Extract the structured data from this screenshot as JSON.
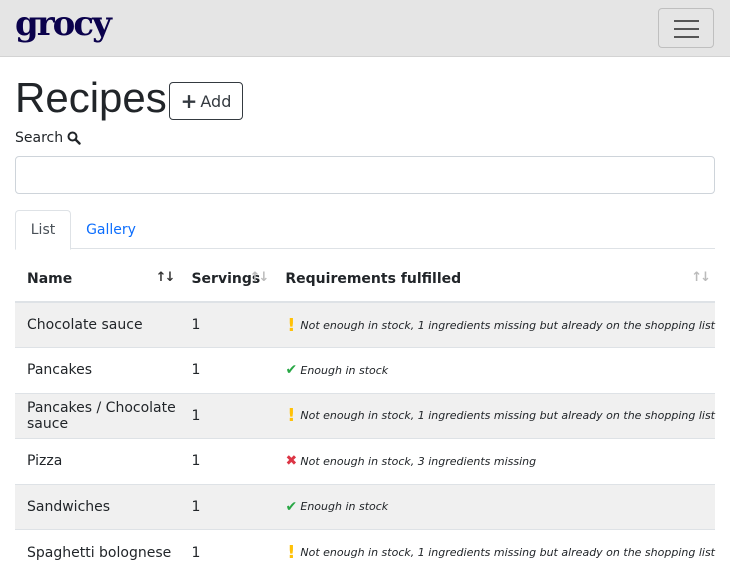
{
  "navbar": {
    "brand": "grocy"
  },
  "header": {
    "title": "Recipes",
    "add_label": "Add"
  },
  "search": {
    "label": "Search",
    "placeholder": "",
    "value": ""
  },
  "tabs": [
    {
      "label": "List"
    },
    {
      "label": "Gallery"
    }
  ],
  "table": {
    "columns": [
      "Name",
      "Servings",
      "Requirements fulfilled"
    ],
    "rows": [
      {
        "name": "Chocolate sauce",
        "servings": "1",
        "status": "warn",
        "requirement": "Not enough in stock, 1 ingredients missing but already on the shopping list"
      },
      {
        "name": "Pancakes",
        "servings": "1",
        "status": "ok",
        "requirement": "Enough in stock"
      },
      {
        "name": "Pancakes / Chocolate sauce",
        "servings": "1",
        "status": "warn",
        "requirement": "Not enough in stock, 1 ingredients missing but already on the shopping list"
      },
      {
        "name": "Pizza",
        "servings": "1",
        "status": "bad",
        "requirement": "Not enough in stock, 3 ingredients missing"
      },
      {
        "name": "Sandwiches",
        "servings": "1",
        "status": "ok",
        "requirement": "Enough in stock"
      },
      {
        "name": "Spaghetti bolognese",
        "servings": "1",
        "status": "warn",
        "requirement": "Not enough in stock, 1 ingredients missing but already on the shopping list"
      }
    ]
  },
  "colors": {
    "brand": "#0b024c",
    "link": "#0d6efd",
    "warn": "#ffc107",
    "ok": "#28a745",
    "bad": "#dc3545"
  }
}
